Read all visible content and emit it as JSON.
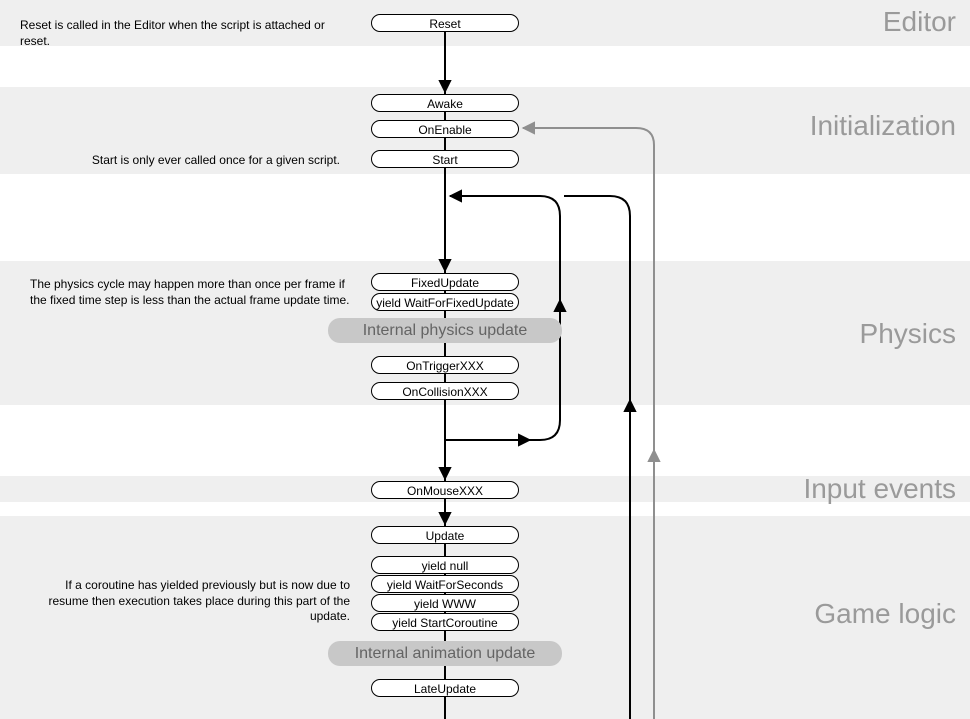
{
  "sections": {
    "editor": {
      "title": "Editor",
      "note": "Reset is called in the Editor when the script is attached or reset."
    },
    "init": {
      "title": "Initialization",
      "note": "Start is only ever called once for a given script."
    },
    "physics": {
      "title": "Physics",
      "note": "The physics cycle may happen more than once per frame if the fixed time step is less than the actual frame update time."
    },
    "input": {
      "title": "Input events"
    },
    "game": {
      "title": "Game logic",
      "note": "If a coroutine has yielded previously but is now due to resume then execution takes place during this part of the update."
    }
  },
  "nodes": {
    "reset": "Reset",
    "awake": "Awake",
    "onEnable": "OnEnable",
    "start": "Start",
    "fixedUpdate": "FixedUpdate",
    "yieldFixed": "yield WaitForFixedUpdate",
    "internalPhys": "Internal physics update",
    "onTrigger": "OnTriggerXXX",
    "onCollision": "OnCollisionXXX",
    "onMouse": "OnMouseXXX",
    "update": "Update",
    "yieldNull": "yield null",
    "yieldSeconds": "yield WaitForSeconds",
    "yieldWWW": "yield WWW",
    "yieldStart": "yield StartCoroutine",
    "internalAnim": "Internal animation update",
    "lateUpdate": "LateUpdate"
  }
}
